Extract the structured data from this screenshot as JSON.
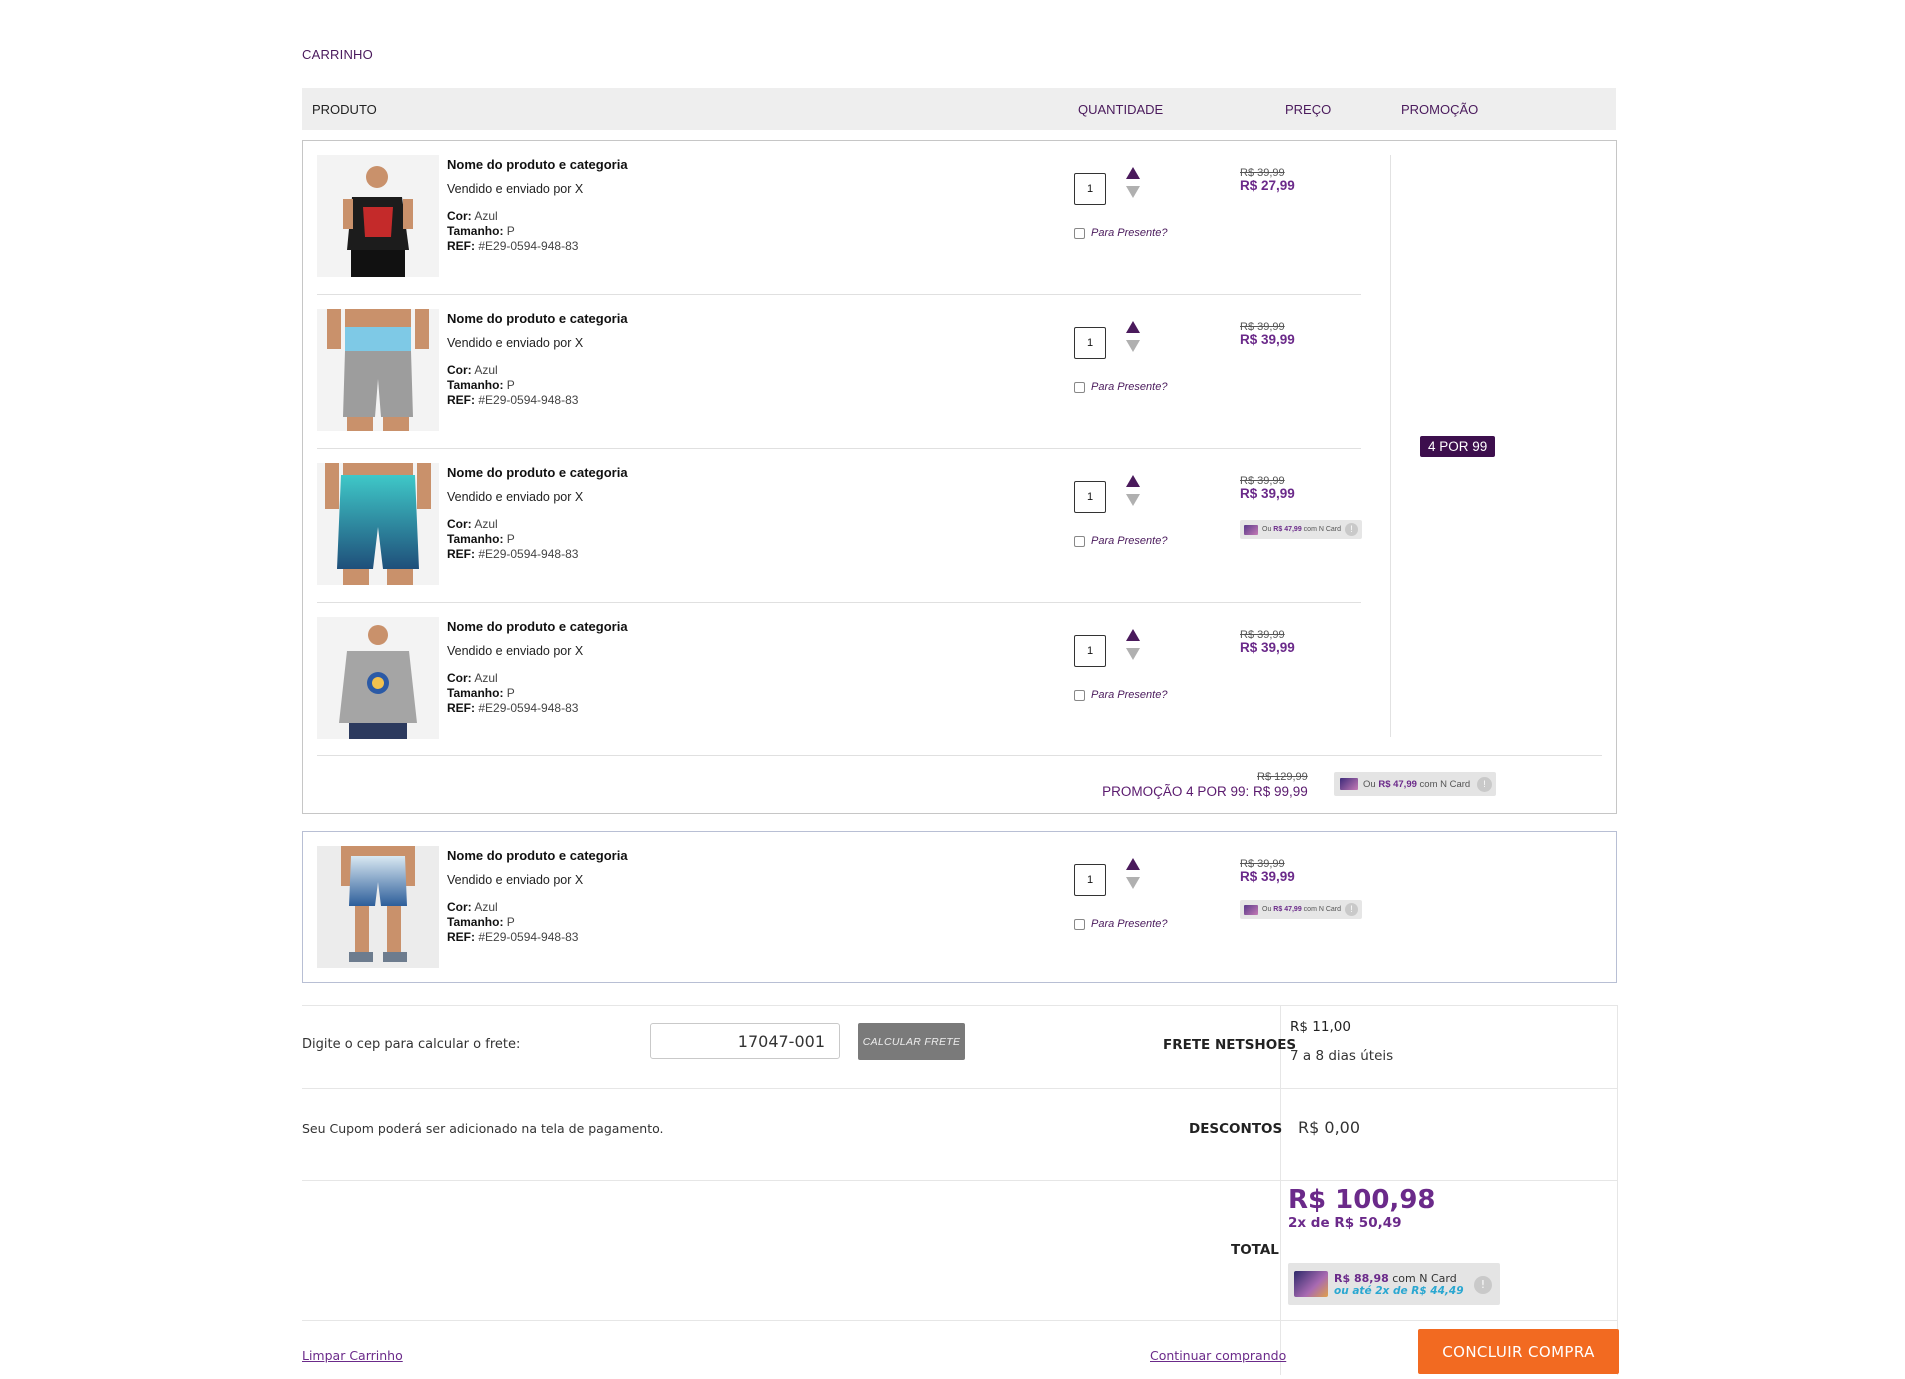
{
  "page": {
    "title": "CARRINHO"
  },
  "table_head": {
    "produto": "PRODUTO",
    "quantidade": "QUANTIDADE",
    "preco": "PREÇO",
    "promocao": "PROMOÇÃO"
  },
  "group_a": {
    "promo_badge": "4 POR 99",
    "items": [
      {
        "name": "Nome do produto e categoria",
        "seller": "Vendido e enviado por X",
        "cor_label": "Cor:",
        "cor": "Azul",
        "tamanho_label": "Tamanho:",
        "tamanho": "P",
        "ref_label": "REF:",
        "ref": "#E29-0594-948-83",
        "qty": "1",
        "gift": "Para Presente?",
        "old_price": "R$ 39,99",
        "price": "R$ 27,99"
      },
      {
        "name": "Nome do produto e categoria",
        "seller": "Vendido e enviado por X",
        "cor_label": "Cor:",
        "cor": "Azul",
        "tamanho_label": "Tamanho:",
        "tamanho": "P",
        "ref_label": "REF:",
        "ref": "#E29-0594-948-83",
        "qty": "1",
        "gift": "Para Presente?",
        "old_price": "R$ 39,99",
        "price": "R$ 39,99"
      },
      {
        "name": "Nome do produto e categoria",
        "seller": "Vendido e enviado por X",
        "cor_label": "Cor:",
        "cor": "Azul",
        "tamanho_label": "Tamanho:",
        "tamanho": "P",
        "ref_label": "REF:",
        "ref": "#E29-0594-948-83",
        "qty": "1",
        "gift": "Para Presente?",
        "old_price": "R$ 39,99",
        "price": "R$ 39,99",
        "ncard": {
          "prefix": "Ou",
          "value": "R$ 47,99",
          "suffix": "com N Card"
        }
      },
      {
        "name": "Nome do produto e categoria",
        "seller": "Vendido e enviado por X",
        "cor_label": "Cor:",
        "cor": "Azul",
        "tamanho_label": "Tamanho:",
        "tamanho": "P",
        "ref_label": "REF:",
        "ref": "#E29-0594-948-83",
        "qty": "1",
        "gift": "Para Presente?",
        "old_price": "R$ 39,99",
        "price": "R$ 39,99"
      }
    ],
    "summary": {
      "old_price": "R$ 129,99",
      "label": "PROMOÇÃO 4 POR 99: R$ 99,99",
      "ncard": {
        "prefix": "Ou",
        "value": "R$ 47,99",
        "suffix": "com N Card"
      }
    }
  },
  "group_b": {
    "item": {
      "name": "Nome do produto e categoria",
      "seller": "Vendido e enviado por X",
      "cor_label": "Cor:",
      "cor": "Azul",
      "tamanho_label": "Tamanho:",
      "tamanho": "P",
      "ref_label": "REF:",
      "ref": "#E29-0594-948-83",
      "qty": "1",
      "gift": "Para Presente?",
      "old_price": "R$ 39,99",
      "price": "R$ 39,99",
      "ncard": {
        "prefix": "Ou",
        "value": "R$ 47,99",
        "suffix": "com N Card"
      }
    }
  },
  "frete": {
    "label": "Digite o cep para calcular o frete:",
    "cep_value": "17047-001",
    "button": "CALCULAR FRETE",
    "title": "FRETE NETSHOES",
    "value": "R$ 11,00",
    "days": "7 a 8 dias úteis"
  },
  "descontos": {
    "info": "Seu Cupom poderá ser adicionado na tela de pagamento.",
    "title": "DESCONTOS",
    "value": "R$ 0,00"
  },
  "total": {
    "title": "TOTAL",
    "value": "R$ 100,98",
    "installments": "2x de  R$ 50,49",
    "ncard": {
      "value": "R$ 88,98",
      "suffix": "com N Card",
      "installments": "ou até 2x de R$ 44,49"
    }
  },
  "actions": {
    "clear": "Limpar Carrinho",
    "continue": "Continuar comprando",
    "checkout": "CONCLUIR COMPRA"
  },
  "colors": {
    "brand_purple": "#6b2a8a",
    "badge_purple": "#3d0f4d",
    "checkout_orange": "#f26a21"
  }
}
